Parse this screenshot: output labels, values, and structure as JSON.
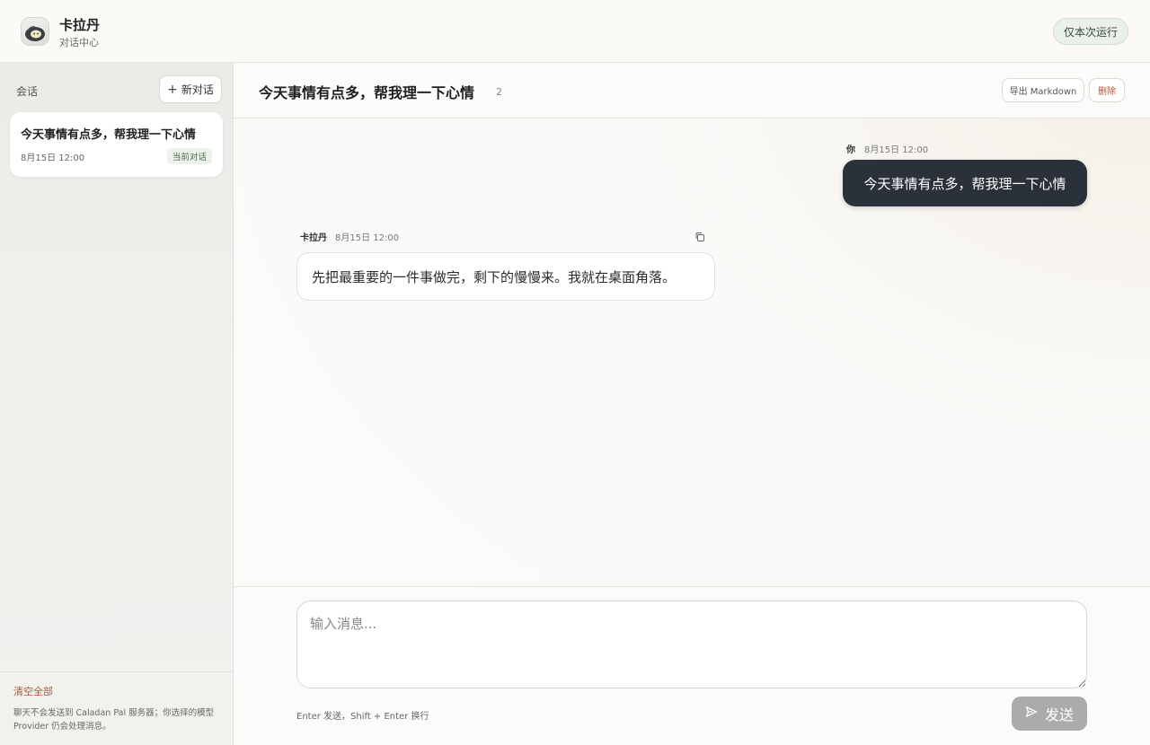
{
  "app": {
    "title": "卡拉丹",
    "subtitle": "对话中心",
    "run_once_label": "仅本次运行"
  },
  "sidebar": {
    "header_label": "会话",
    "new_chat_label": "新对话",
    "conversations": [
      {
        "title": "今天事情有点多，帮我理一下心情",
        "time": "8月15日 12:00",
        "badge": "当前对话"
      }
    ],
    "clear_all_label": "清空全部",
    "privacy_note": "聊天不会发送到 Caladan Pal 服务器；你选择的模型 Provider 仍会处理消息。"
  },
  "chat": {
    "title": "今天事情有点多，帮我理一下心情",
    "message_count": "2",
    "export_label": "导出 Markdown",
    "delete_label": "删除",
    "messages": [
      {
        "sender": "你",
        "time": "8月15日 12:00",
        "text": "今天事情有点多，帮我理一下心情"
      },
      {
        "sender": "卡拉丹",
        "time": "8月15日 12:00",
        "text": "先把最重要的一件事做完，剩下的慢慢来。我就在桌面角落。"
      }
    ]
  },
  "composer": {
    "placeholder": "输入消息...",
    "value": "",
    "hint": "Enter 发送，Shift + Enter 换行",
    "send_label": "发送"
  },
  "colors": {
    "user_bubble": "#2b313b",
    "danger": "#b0553a",
    "send_disabled": "#a9abad"
  }
}
